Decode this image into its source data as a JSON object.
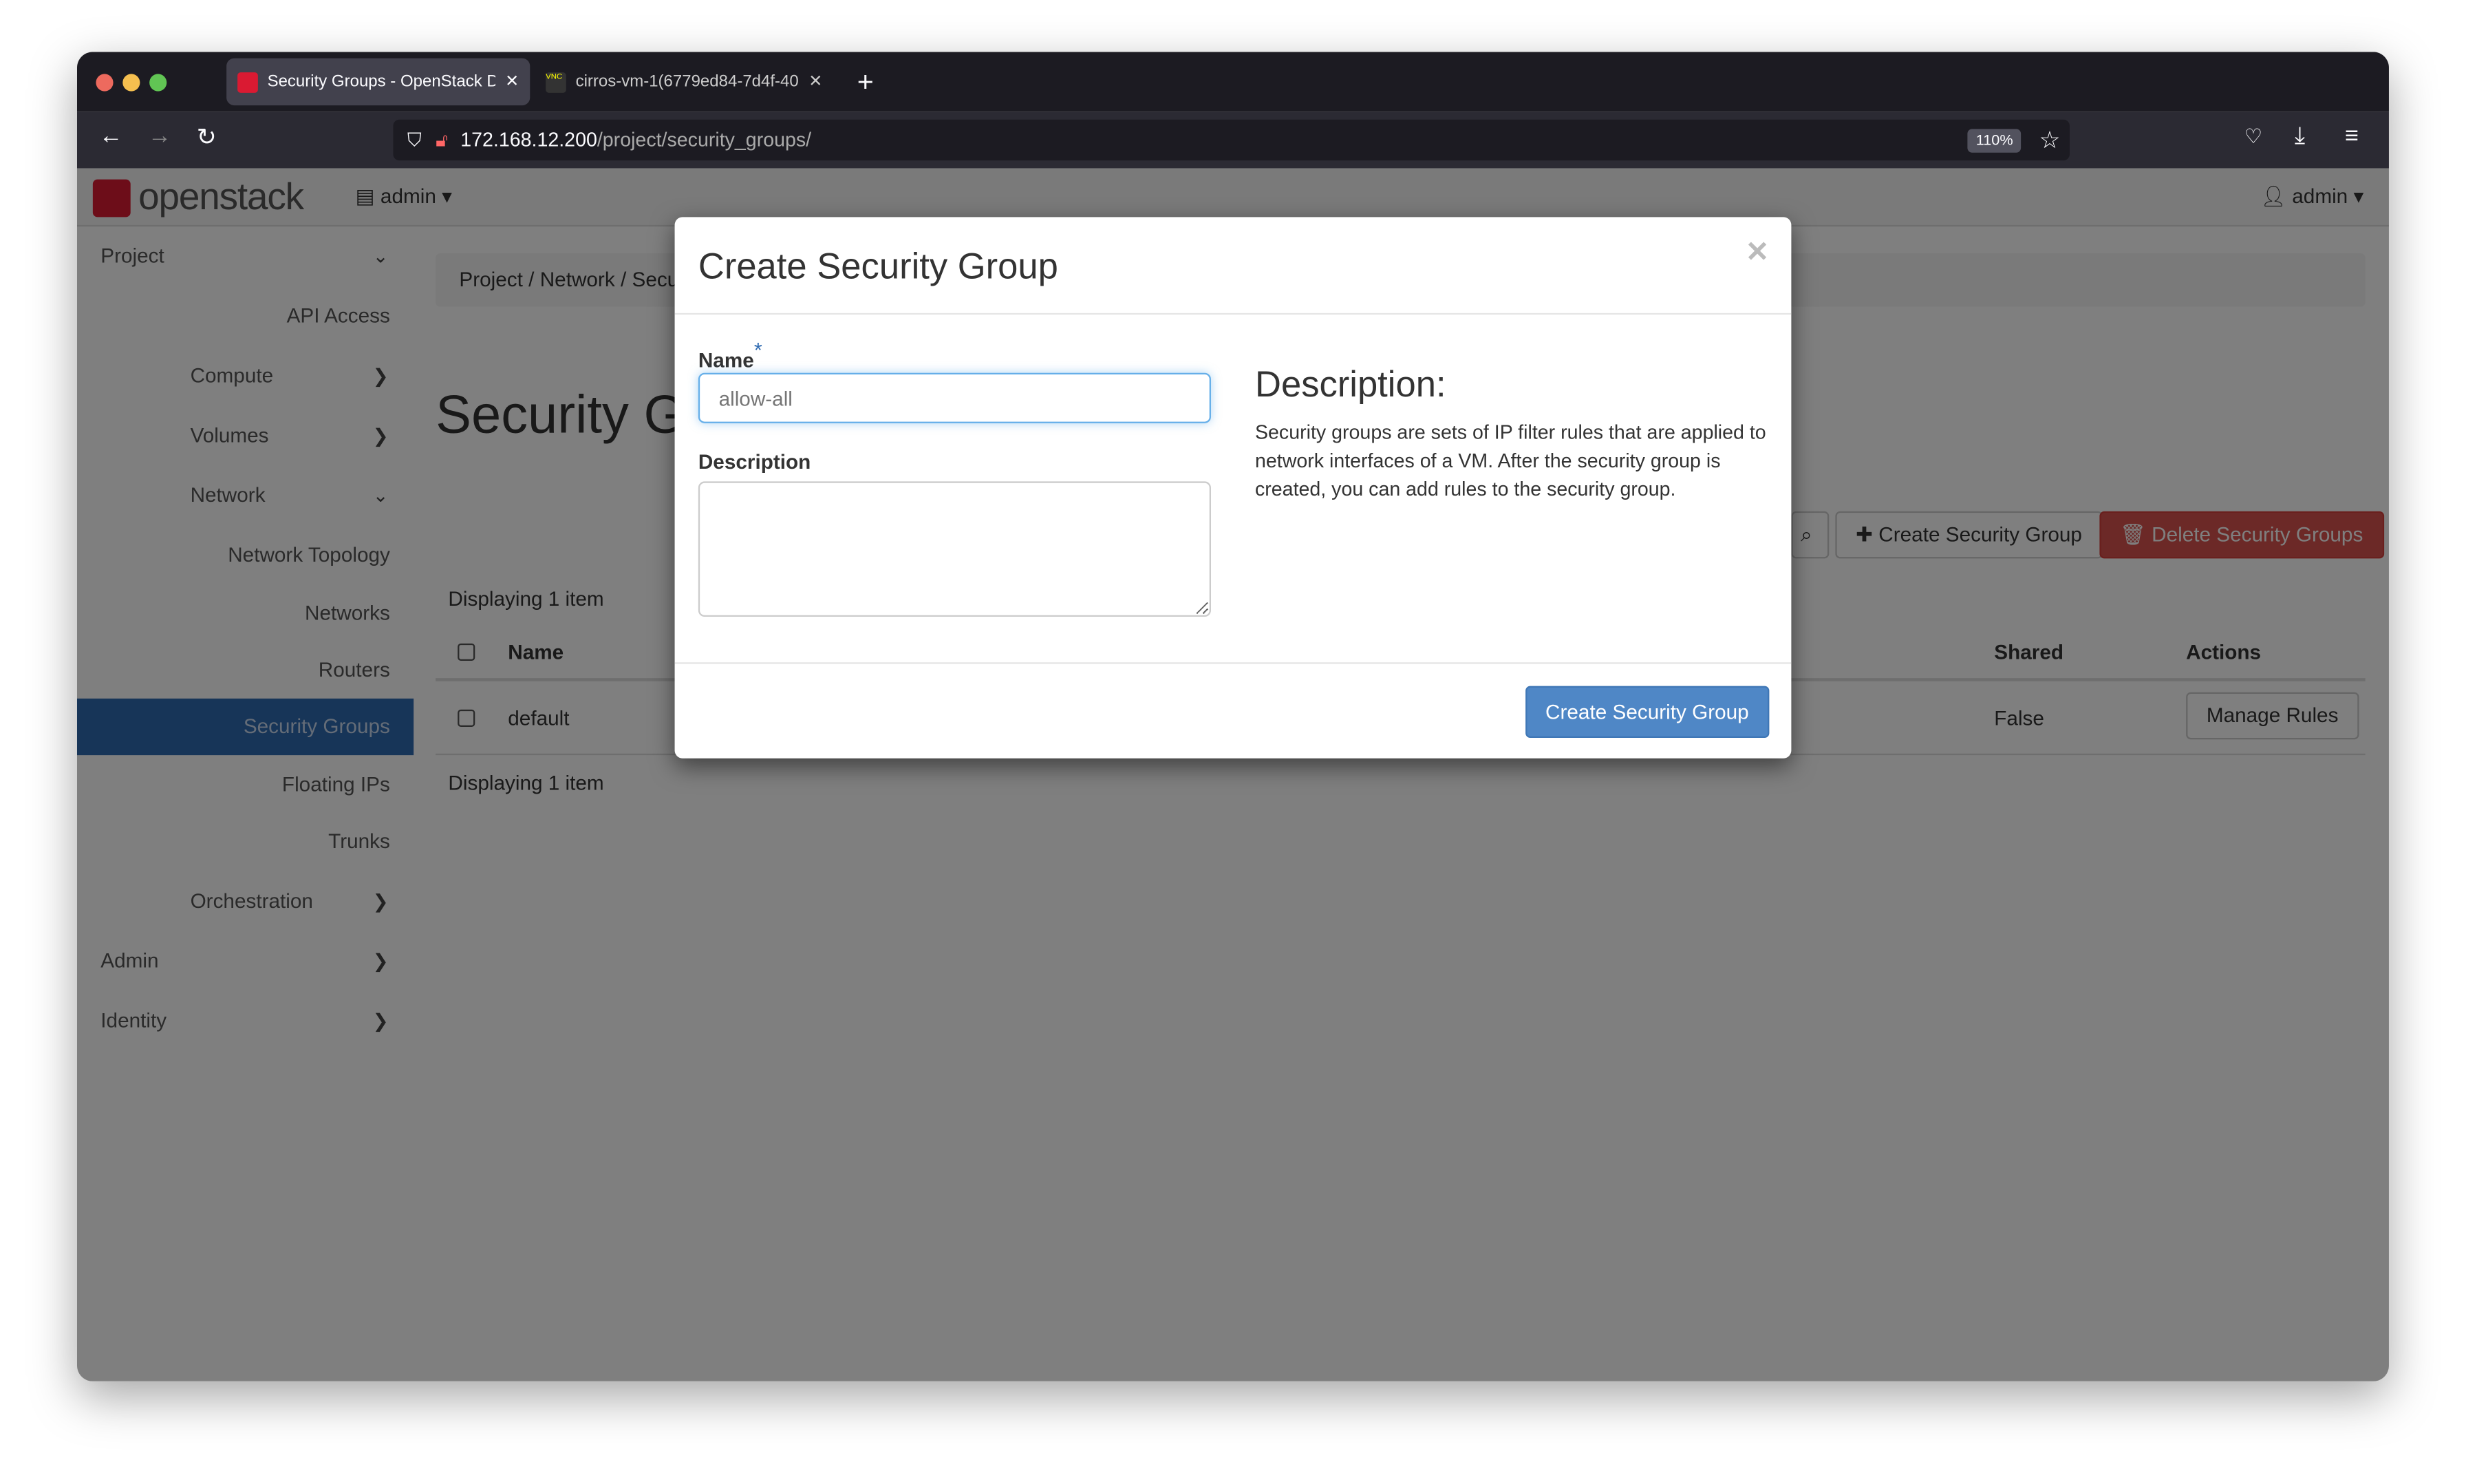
{
  "browser": {
    "tabs": [
      {
        "title": "Security Groups - OpenStack Dashboard",
        "active": true
      },
      {
        "title": "cirros-vm-1(6779ed84-7d4f-40",
        "active": false
      }
    ],
    "url_host": "172.168.12.200",
    "url_path": "/project/security_groups/",
    "zoom": "110%"
  },
  "header": {
    "logo": "openstack",
    "project_menu": "admin",
    "user_menu": "admin"
  },
  "sidebar": {
    "items": [
      {
        "label": "Project",
        "style": "l",
        "chev": "⌄"
      },
      {
        "label": "API Access",
        "style": "r"
      },
      {
        "label": "Compute",
        "style": "c",
        "chev": "›"
      },
      {
        "label": "Volumes",
        "style": "c",
        "chev": "›"
      },
      {
        "label": "Network",
        "style": "c",
        "chev": "⌄"
      },
      {
        "label": "Network Topology",
        "style": "r"
      },
      {
        "label": "Networks",
        "style": "r"
      },
      {
        "label": "Routers",
        "style": "r"
      },
      {
        "label": "Security Groups",
        "style": "r",
        "active": true
      },
      {
        "label": "Floating IPs",
        "style": "r"
      },
      {
        "label": "Trunks",
        "style": "r"
      },
      {
        "label": "Orchestration",
        "style": "c",
        "chev": "›"
      },
      {
        "label": "Admin",
        "style": "l",
        "chev": "›"
      },
      {
        "label": "Identity",
        "style": "l",
        "chev": "›"
      }
    ]
  },
  "main": {
    "breadcrumb": [
      "Project",
      "Network",
      "Security Groups"
    ],
    "title": "Security Groups",
    "create_button": "Create Security Group",
    "delete_button": "Delete Security Groups",
    "displaying": "Displaying 1 item",
    "columns": {
      "name": "Name",
      "shared": "Shared",
      "actions": "Actions"
    },
    "rows": [
      {
        "name": "default",
        "shared": "False",
        "action": "Manage Rules"
      }
    ]
  },
  "modal": {
    "title": "Create Security Group",
    "name_label": "Name",
    "required_mark": "*",
    "name_placeholder": "allow-all",
    "description_label": "Description",
    "help_title": "Description:",
    "help_text": "Security groups are sets of IP filter rules that are applied to network interfaces of a VM. After the security group is created, you can add rules to the security group.",
    "submit": "Create Security Group"
  },
  "colors": {
    "accent": "#2e6ab1",
    "danger": "#d9534f",
    "primary_button": "#4f87c6"
  }
}
